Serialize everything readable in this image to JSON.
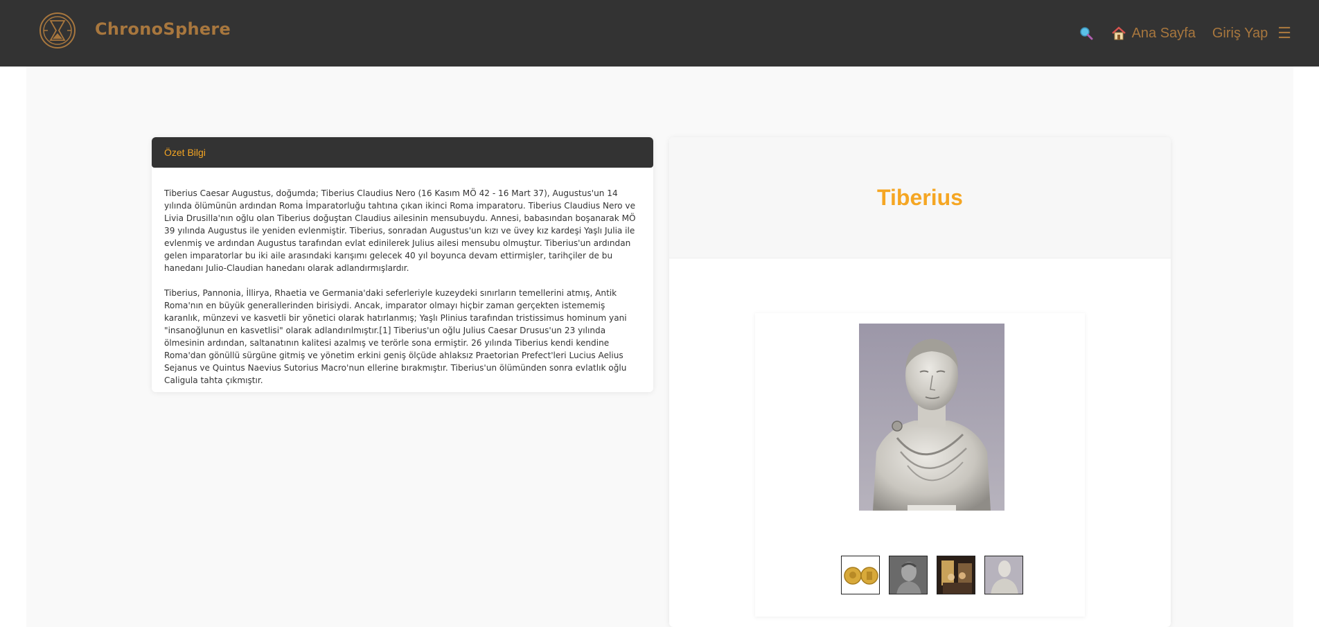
{
  "navbar": {
    "brand": "ChronoSphere",
    "home_label": "Ana Sayfa",
    "login_label": "Giriş Yap",
    "menu_glyph": "☰",
    "brand_color": "#a8773e",
    "search_icon": "search-icon",
    "home_icon": "house-icon"
  },
  "summary": {
    "header": "Özet Bilgi",
    "paragraphs": [
      "Tiberius Caesar Augustus, doğumda; Tiberius Claudius Nero (16 Kasım MÖ 42 - 16 Mart 37), Augustus'un 14 yılında ölümünün ardından Roma İmparatorluğu tahtına çıkan ikinci Roma imparatoru. Tiberius Claudius Nero ve Livia Drusilla'nın oğlu olan Tiberius doğuştan Claudius ailesinin mensubuydu. Annesi, babasından boşanarak MÖ 39 yılında Augustus ile yeniden evlenmiştir. Tiberius, sonradan Augustus'un kızı ve üvey kız kardeşi Yaşlı Julia ile evlenmiş ve ardından Augustus tarafından evlat edinilerek Julius ailesi mensubu olmuştur. Tiberius'un ardından gelen imparatorlar bu iki aile arasındaki karışımı gelecek 40 yıl boyunca devam ettirmişler, tarihçiler de bu hanedanı Julio-Claudian hanedanı olarak adlandırmışlardır.",
      "Tiberius, Pannonia, İllirya, Rhaetia ve Germania'daki seferleriyle kuzeydeki sınırların temellerini atmış, Antik Roma'nın en büyük generallerinden birisiydi. Ancak, imparator olmayı hiçbir zaman gerçekten istememiş karanlık, münzevi ve kasvetli bir yönetici olarak hatırlanmış; Yaşlı Plinius tarafından tristissimus hominum yani \"insanoğlunun en kasvetlisi\" olarak adlandırılmıştır.[1] Tiberius'un oğlu Julius Caesar Drusus'un 23 yılında ölmesinin ardından, saltanatının kalitesi azalmış ve terörle sona ermiştir. 26 yılında Tiberius kendi kendine Roma'dan gönüllü sürgüne gitmiş ve yönetim erkini geniş ölçüde ahlaksız Praetorian Prefect'leri Lucius Aelius Sejanus ve Quintus Naevius Sutorius Macro'nun ellerine bırakmıştır. Tiberius'un ölümünden sonra evlatlık oğlu Caligula tahta çıkmıştır."
    ]
  },
  "profile": {
    "name": "Tiberius",
    "accent_color": "#f5a623",
    "thumbnails": [
      "coins-thumbnail",
      "bust-profile-thumbnail",
      "painting-thumbnail",
      "bust-thumbnail"
    ]
  }
}
